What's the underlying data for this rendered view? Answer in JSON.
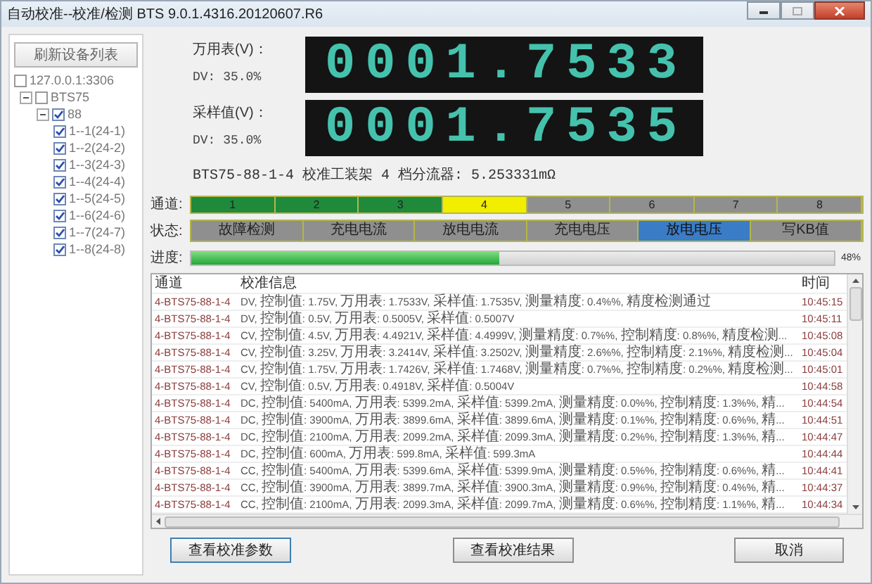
{
  "window": {
    "title": "自动校准--校准/检测 BTS 9.0.1.4316.20120607.R6"
  },
  "device_tree": {
    "refresh_button": "刷新设备列表",
    "nodes": [
      {
        "label": "127.0.0.1:3306",
        "checked": false,
        "children": [
          {
            "label": "BTS75",
            "checked": false,
            "expanded": true,
            "children": [
              {
                "label": "88",
                "checked": true,
                "expanded": true,
                "children": [
                  {
                    "label": "1--1(24-1)",
                    "checked": true
                  },
                  {
                    "label": "1--2(24-2)",
                    "checked": true
                  },
                  {
                    "label": "1--3(24-3)",
                    "checked": true
                  },
                  {
                    "label": "1--4(24-4)",
                    "checked": true
                  },
                  {
                    "label": "1--5(24-5)",
                    "checked": true
                  },
                  {
                    "label": "1--6(24-6)",
                    "checked": true
                  },
                  {
                    "label": "1--7(24-7)",
                    "checked": true
                  },
                  {
                    "label": "1--8(24-8)",
                    "checked": true
                  }
                ]
              }
            ]
          }
        ]
      }
    ]
  },
  "meters": [
    {
      "label": "万用表(V)：",
      "mode": "DV: 35.0%",
      "reading": "0001.7533"
    },
    {
      "label": "采样值(V)：",
      "mode": "DV: 35.0%",
      "reading": "0001.7535"
    }
  ],
  "fixture_info": "BTS75-88-1-4 校准工装架 4 档分流器: 5.253331mΩ",
  "channels": {
    "label": "通道:",
    "items": [
      {
        "label": "1",
        "color": "#1f8a3c"
      },
      {
        "label": "2",
        "color": "#1f8a3c"
      },
      {
        "label": "3",
        "color": "#1f8a3c"
      },
      {
        "label": "4",
        "color": "#f2ee00"
      },
      {
        "label": "5",
        "color": "#8f8f8f"
      },
      {
        "label": "6",
        "color": "#8f8f8f"
      },
      {
        "label": "7",
        "color": "#8f8f8f"
      },
      {
        "label": "8",
        "color": "#8f8f8f"
      }
    ]
  },
  "stages": {
    "label": "状态:",
    "items": [
      {
        "label": "故障检测",
        "selected": false
      },
      {
        "label": "充电电流",
        "selected": false
      },
      {
        "label": "放电电流",
        "selected": false
      },
      {
        "label": "充电电压",
        "selected": false
      },
      {
        "label": "放电电压",
        "selected": true
      },
      {
        "label": "写KB值",
        "selected": false
      }
    ]
  },
  "progress": {
    "label": "进度:",
    "level": 0.48,
    "reading": "48%"
  },
  "log_table": {
    "columns": [
      "通道",
      "校准信息",
      "时间"
    ],
    "rows": [
      {
        "channel": "4-BTS75-88-1-4",
        "info": "DV, 控制值: 1.75V, 万用表: 1.7533V, 采样值: 1.7535V, 测量精度: 0.4%%, 精度检测通过",
        "time": "10:45:15"
      },
      {
        "channel": "4-BTS75-88-1-4",
        "info": "DV, 控制值: 0.5V, 万用表: 0.5005V, 采样值: 0.5007V",
        "time": "10:45:11"
      },
      {
        "channel": "4-BTS75-88-1-4",
        "info": "CV, 控制值: 4.5V, 万用表: 4.4921V, 采样值: 4.4999V, 测量精度: 0.7%%, 控制精度: 0.8%%, 精度检测...",
        "time": "10:45:08"
      },
      {
        "channel": "4-BTS75-88-1-4",
        "info": "CV, 控制值: 3.25V, 万用表: 3.2414V, 采样值: 3.2502V, 测量精度: 2.6%%, 控制精度: 2.1%%, 精度检测...",
        "time": "10:45:04"
      },
      {
        "channel": "4-BTS75-88-1-4",
        "info": "CV, 控制值: 1.75V, 万用表: 1.7426V, 采样值: 1.7468V, 测量精度: 0.7%%, 控制精度: 0.2%%, 精度检测...",
        "time": "10:45:01"
      },
      {
        "channel": "4-BTS75-88-1-4",
        "info": "CV, 控制值: 0.5V, 万用表: 0.4918V, 采样值: 0.5004V",
        "time": "10:44:58"
      },
      {
        "channel": "4-BTS75-88-1-4",
        "info": "DC, 控制值: 5400mA, 万用表: 5399.2mA, 采样值: 5399.2mA, 测量精度: 0.0%%, 控制精度: 1.3%%, 精...",
        "time": "10:44:54"
      },
      {
        "channel": "4-BTS75-88-1-4",
        "info": "DC, 控制值: 3900mA, 万用表: 3899.6mA, 采样值: 3899.6mA, 测量精度: 0.1%%, 控制精度: 0.6%%, 精...",
        "time": "10:44:51"
      },
      {
        "channel": "4-BTS75-88-1-4",
        "info": "DC, 控制值: 2100mA, 万用表: 2099.2mA, 采样值: 2099.3mA, 测量精度: 0.2%%, 控制精度: 1.3%%, 精...",
        "time": "10:44:47"
      },
      {
        "channel": "4-BTS75-88-1-4",
        "info": "DC, 控制值: 600mA, 万用表: 599.8mA, 采样值: 599.3mA",
        "time": "10:44:44"
      },
      {
        "channel": "4-BTS75-88-1-4",
        "info": "CC, 控制值: 5400mA, 万用表: 5399.6mA, 采样值: 5399.9mA, 测量精度: 0.5%%, 控制精度: 0.6%%, 精...",
        "time": "10:44:41"
      },
      {
        "channel": "4-BTS75-88-1-4",
        "info": "CC, 控制值: 3900mA, 万用表: 3899.7mA, 采样值: 3900.3mA, 测量精度: 0.9%%, 控制精度: 0.4%%, 精...",
        "time": "10:44:37"
      },
      {
        "channel": "4-BTS75-88-1-4",
        "info": "CC, 控制值: 2100mA, 万用表: 2099.3mA, 采样值: 2099.7mA, 测量精度: 0.6%%, 控制精度: 1.1%%, 精...",
        "time": "10:44:34"
      }
    ]
  },
  "buttons": [
    "查看校准参数",
    "查看校准结果",
    "取消"
  ]
}
